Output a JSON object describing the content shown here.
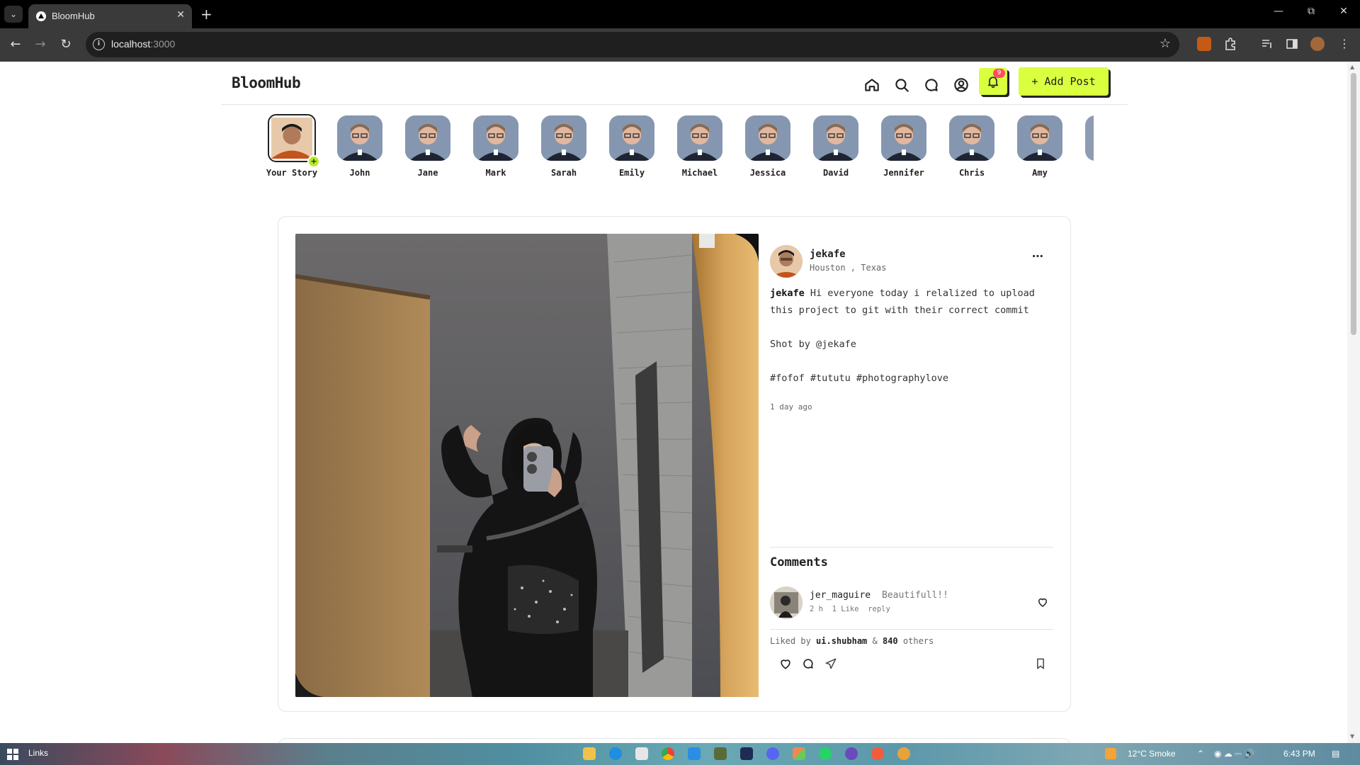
{
  "browser": {
    "tab_title": "BloomHub",
    "url_host": "localhost",
    "url_port": ":3000"
  },
  "app": {
    "logo": "BloomHub",
    "notification_count": "9",
    "add_post_label": "+ Add Post"
  },
  "stories": [
    {
      "name": "Your Story",
      "own": true
    },
    {
      "name": "John"
    },
    {
      "name": "Jane"
    },
    {
      "name": "Mark"
    },
    {
      "name": "Sarah"
    },
    {
      "name": "Emily"
    },
    {
      "name": "Michael"
    },
    {
      "name": "Jessica"
    },
    {
      "name": "David"
    },
    {
      "name": "Jennifer"
    },
    {
      "name": "Chris"
    },
    {
      "name": "Amy"
    }
  ],
  "post": {
    "author": "jekafe",
    "location": "Houston , Texas",
    "caption_author": "jekafe",
    "caption_text": "Hi everyone today i relalized to upload this project to git with their correct commit",
    "caption_shot": "Shot by @jekafe",
    "caption_tags": "#fofof #tututu #photographylove",
    "time_ago": "1 day ago",
    "comments_title": "Comments",
    "comments": [
      {
        "user": "jer_maguire",
        "text": "Beautifull!!",
        "time": "2 h",
        "likes": "1 Like",
        "reply": "reply"
      }
    ],
    "liked_prefix": "Liked by",
    "liked_user": "ui.shubham",
    "liked_amp": "&",
    "liked_count": "840",
    "liked_suffix": "others"
  },
  "taskbar": {
    "label": "Links",
    "weather": "12°C  Smoke",
    "time": "6:43 PM"
  },
  "colors": {
    "accent": "#d9ff3e",
    "badge": "#ff4d5e"
  }
}
